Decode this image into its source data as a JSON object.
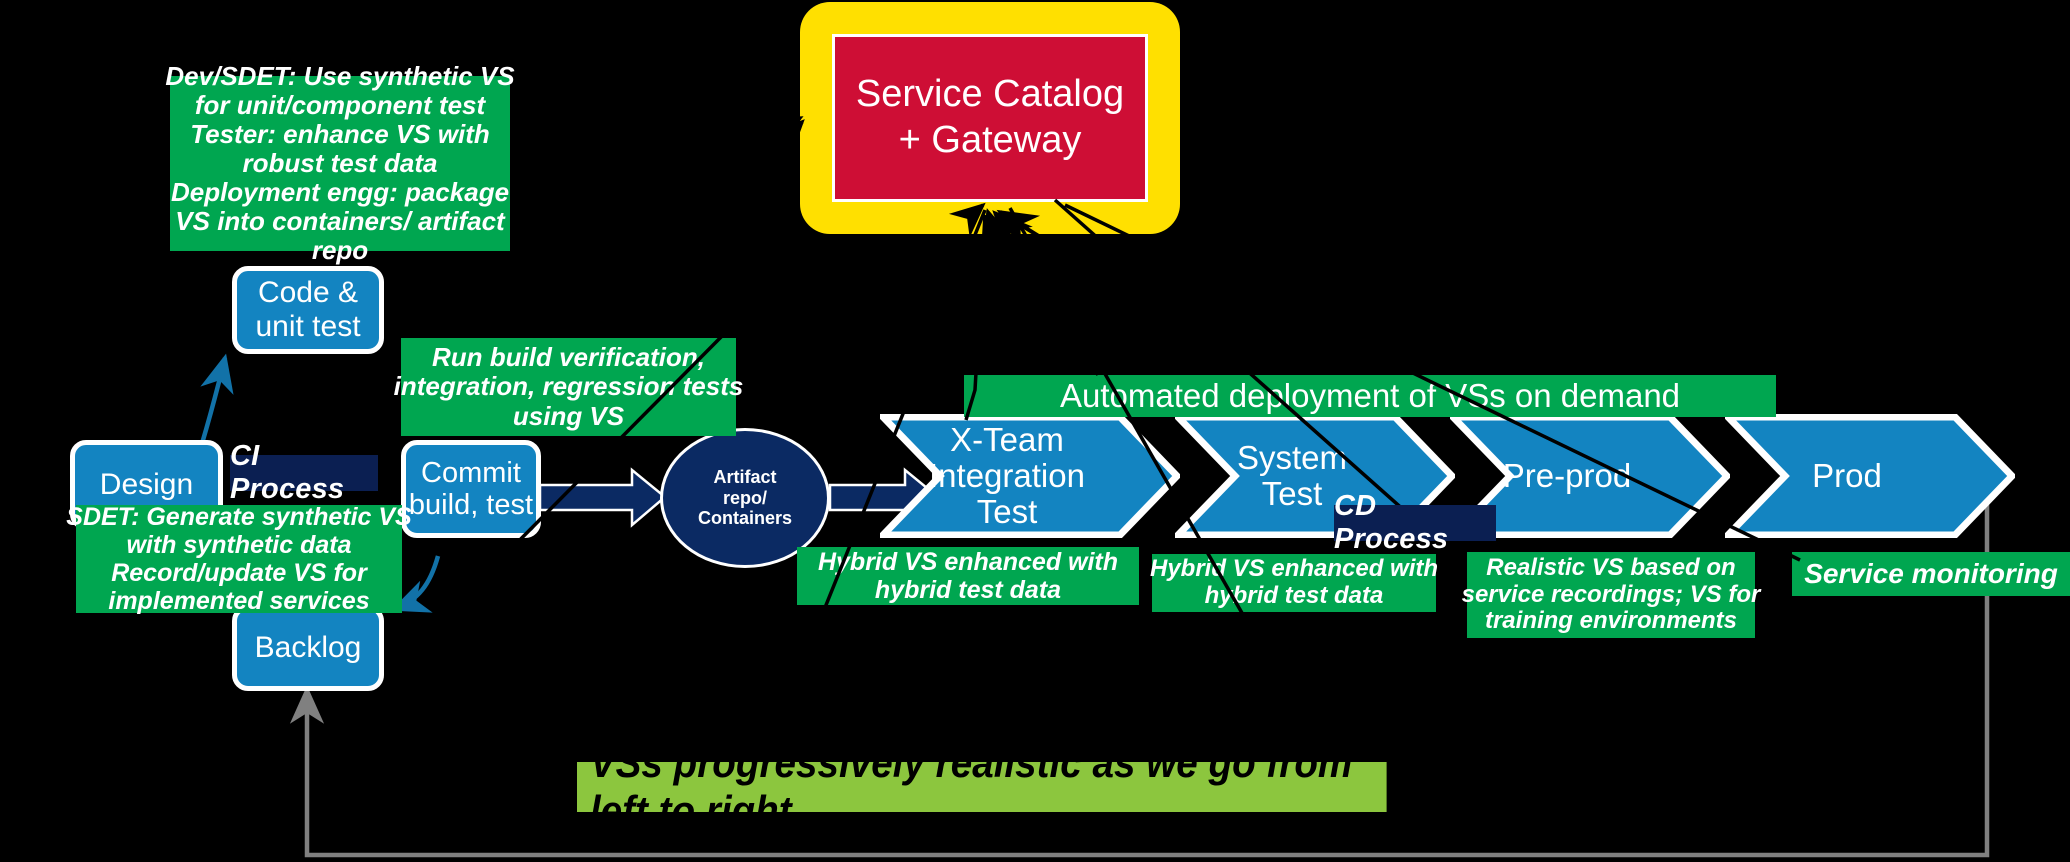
{
  "diagram": {
    "title_banner": "VSs progressively realistic as we go from left to right",
    "accent_colors": {
      "green_note": "#00A650",
      "blue_node": "#1384C1",
      "navy_label": "#0B1F52",
      "catalog_border": "#FFE000",
      "catalog_fill": "#CE0E35",
      "banner_green": "#8CC63E",
      "artifact_navy": "#0B2A63",
      "background": "#000000"
    }
  },
  "catalog": {
    "line1": "Service Catalog",
    "line2": "+ Gateway"
  },
  "notes": {
    "dev_sdet": [
      "Dev/SDET: Use synthetic VS",
      "for unit/component test",
      "Tester: enhance VS with",
      "robust test data",
      "Deployment engg: package",
      "VS into containers/ artifact",
      "repo"
    ],
    "sdet_generate": [
      "SDET: Generate synthetic VS",
      "with synthetic data",
      "Record/update VS for",
      "implemented services"
    ],
    "run_build": [
      "Run build verification,",
      "integration, regression tests",
      "using VS"
    ],
    "automated_deployment": "Automated  deployment of VSs on demand",
    "hybrid_vs_1": [
      "Hybrid VS enhanced with",
      "hybrid test data"
    ],
    "hybrid_vs_2": [
      "Hybrid VS enhanced with",
      "hybrid test data"
    ],
    "realistic_vs": [
      "Realistic VS based on",
      "service recordings; VS for",
      "training environments"
    ],
    "service_monitoring": "Service monitoring"
  },
  "nodes": {
    "code_unit_test": [
      "Code &",
      "unit test"
    ],
    "design": [
      "Design"
    ],
    "commit_build_test": [
      "Commit",
      "build, test"
    ],
    "backlog": [
      "Backlog"
    ],
    "artifact_repo": [
      "Artifact",
      "repo/",
      "Containers"
    ]
  },
  "process_labels": {
    "ci": "CI Process",
    "cd": "CD Process"
  },
  "stages": [
    {
      "id": "x-team-integration-test",
      "lines": [
        "X-Team",
        "Integration",
        "Test"
      ]
    },
    {
      "id": "system-test",
      "lines": [
        "System",
        "Test"
      ]
    },
    {
      "id": "pre-prod",
      "lines": [
        "Pre-prod"
      ]
    },
    {
      "id": "prod",
      "lines": [
        "Prod"
      ]
    }
  ]
}
